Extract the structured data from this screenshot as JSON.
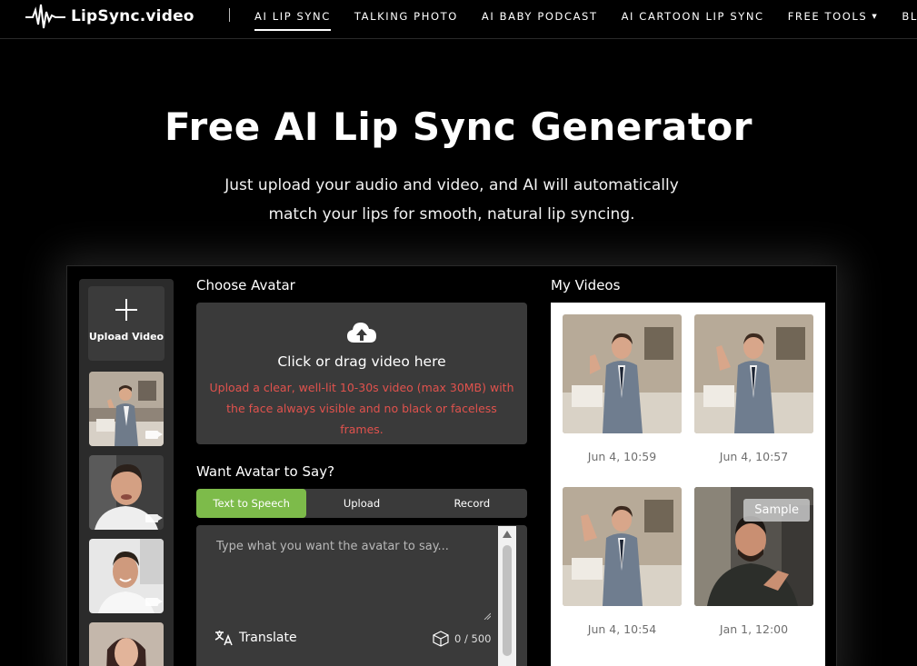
{
  "nav": {
    "brand": "LipSync.video",
    "items": [
      {
        "label": "AI LIP SYNC",
        "active": true
      },
      {
        "label": "TALKING PHOTO",
        "active": false
      },
      {
        "label": "AI BABY PODCAST",
        "active": false
      },
      {
        "label": "AI CARTOON LIP SYNC",
        "active": false
      },
      {
        "label": "FREE TOOLS",
        "active": false,
        "has_dropdown": true
      },
      {
        "label": "BLOG",
        "active": false
      }
    ]
  },
  "hero": {
    "title": "Free AI Lip Sync Generator",
    "subtitle": "Just upload your audio and video, and AI will automatically match your lips for smooth, natural lip syncing."
  },
  "avatars": {
    "upload_label": "Upload Video",
    "thumbnails": [
      "man-in-suit-video",
      "man-in-white-tshirt-video",
      "man-smiling-video",
      "woman-video"
    ]
  },
  "choose_avatar": {
    "title": "Choose Avatar",
    "dropzone_main": "Click or drag video here",
    "dropzone_hint": "Upload a clear, well-lit 10-30s video (max 30MB) with the face always visible and no black or faceless frames."
  },
  "say": {
    "title": "Want Avatar to Say?",
    "tabs": [
      {
        "label": "Text to Speech",
        "active": true
      },
      {
        "label": "Upload",
        "active": false
      },
      {
        "label": "Record",
        "active": false
      }
    ],
    "placeholder": "Type what you want the avatar to say...",
    "translate_label": "Translate",
    "char_count": "0 / 500"
  },
  "my_videos": {
    "title": "My Videos",
    "items": [
      {
        "date": "Jun 4, 10:59",
        "sample": false
      },
      {
        "date": "Jun 4, 10:57",
        "sample": false
      },
      {
        "date": "Jun 4, 10:54",
        "sample": false
      },
      {
        "date": "Jan 1, 12:00",
        "sample": true,
        "badge": "Sample"
      }
    ]
  },
  "colors": {
    "accent_green": "#7dbb4a",
    "warning_red": "#e0524d",
    "panel_gray": "#3a3a3a"
  }
}
